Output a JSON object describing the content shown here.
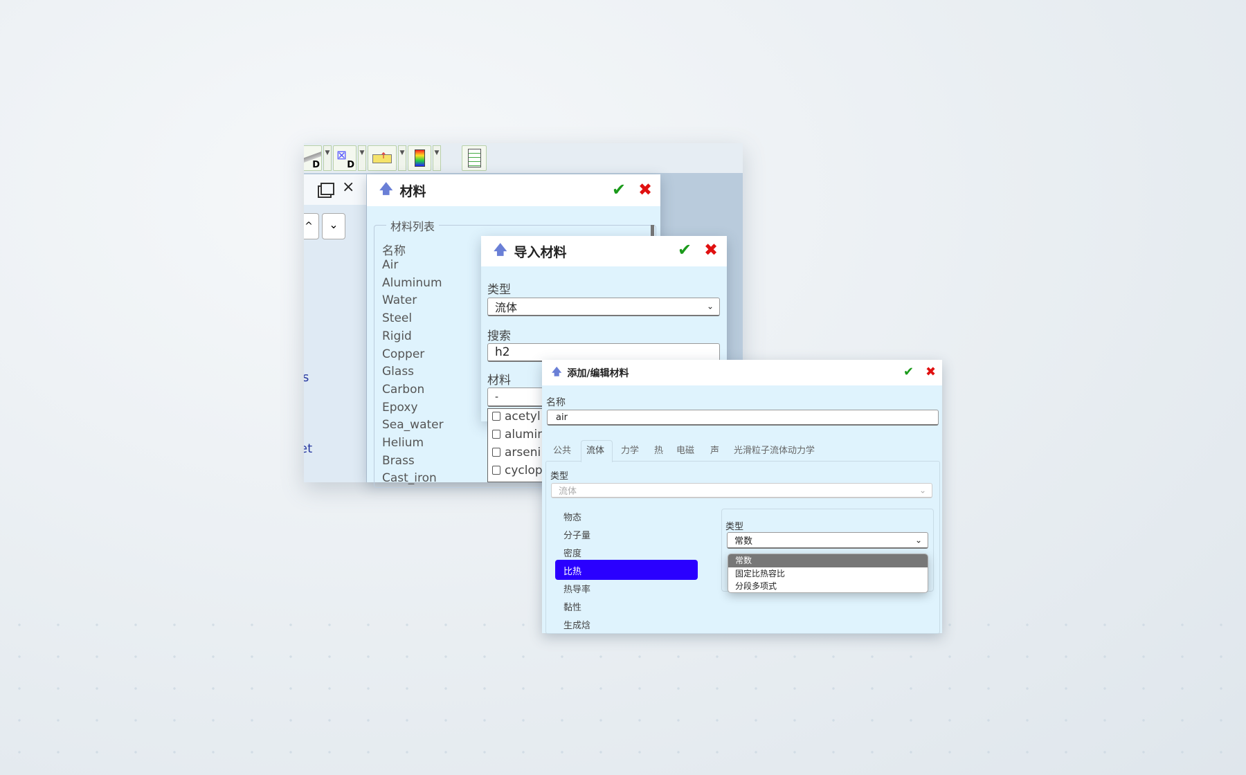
{
  "left_panel": {
    "restore_icon": "restore-window-icon",
    "close_label": "×",
    "up_label": "^",
    "down_label": "⌄",
    "fragment_1": "s",
    "fragment_2": "et"
  },
  "toolbar": {
    "icons": [
      "extrude-d-icon",
      "mesh-d-icon",
      "import-icon",
      "color-map-icon",
      "checklist-icon"
    ]
  },
  "materials_dialog": {
    "title": "材料",
    "group_title": "材料列表",
    "header": "名称",
    "items": [
      "Air",
      "Aluminum",
      "Water",
      "Steel",
      "Rigid",
      "Copper",
      "Glass",
      "Carbon",
      "Epoxy",
      "Sea_water",
      "Helium",
      "Brass",
      "Cast_iron"
    ]
  },
  "import_dialog": {
    "title": "导入材料",
    "type_label": "类型",
    "type_value": "流体",
    "search_label": "搜索",
    "search_value": "h2",
    "material_label": "材料",
    "material_value": "-",
    "items": [
      "acetyl",
      "alumin",
      "arseni",
      "cyclop"
    ]
  },
  "edit_dialog": {
    "title": "添加/编辑材料",
    "name_label": "名称",
    "name_value": "air",
    "tabs": [
      "公共",
      "流体",
      "力学",
      "热",
      "电磁",
      "声",
      "光滑粒子流体动力学"
    ],
    "active_tab": "流体",
    "type_label": "类型",
    "type_value": "流体",
    "properties": [
      "物态",
      "分子量",
      "密度",
      "比热",
      "热导率",
      "黏性",
      "生成焓"
    ],
    "selected_property": "比热",
    "sub_type_label": "类型",
    "sub_type_value": "常数",
    "sub_type_options": [
      "常数",
      "固定比热容比",
      "分段多项式"
    ]
  },
  "colors": {
    "selected": "#2a00ff",
    "ok": "#1a9a1a",
    "cancel": "#e01010",
    "dialog_bg": "#dff3fd"
  }
}
